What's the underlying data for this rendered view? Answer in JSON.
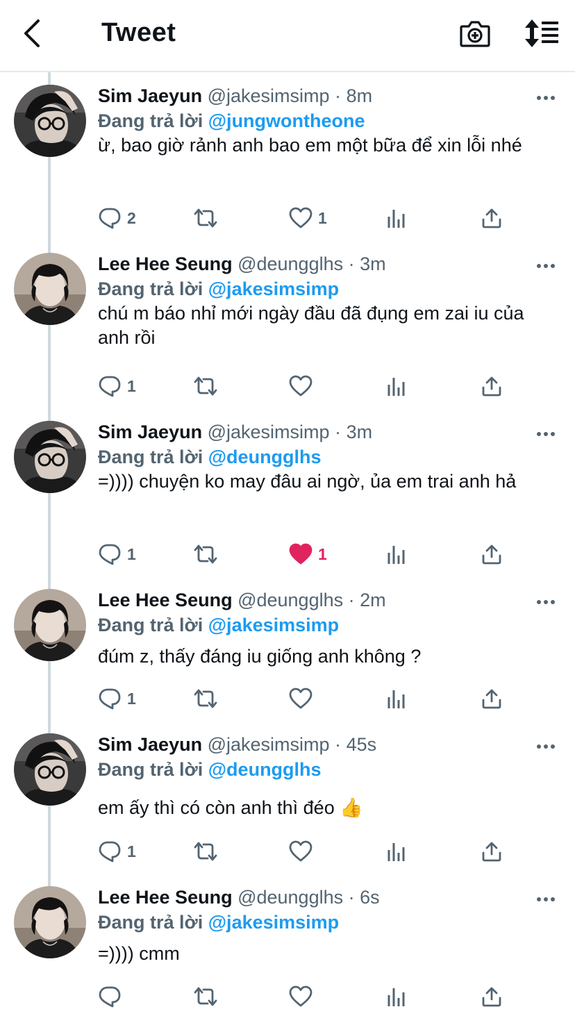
{
  "header": {
    "title": "Tweet"
  },
  "tweets": [
    {
      "avatar": "sim",
      "name": "Sim Jaeyun",
      "handle": "@jakesimsimp",
      "sep": "·",
      "time": "8m",
      "replying_label": "Đang trả lời",
      "replying_to": "@jungwontheone",
      "text": "ừ, bao giờ rảnh anh bao em một bữa để xin lỗi nhé",
      "replies": "2",
      "retweets": "",
      "likes": "1",
      "liked": false
    },
    {
      "avatar": "lee",
      "name": "Lee Hee Seung",
      "handle": "@deungglhs",
      "sep": "·",
      "time": "3m",
      "replying_label": "Đang trả lời",
      "replying_to": "@jakesimsimp",
      "text": "chú m báo nhỉ mới ngày đầu đã đụng em zai iu của anh rồi",
      "replies": "1",
      "retweets": "",
      "likes": "",
      "liked": false
    },
    {
      "avatar": "sim",
      "name": "Sim Jaeyun",
      "handle": "@jakesimsimp",
      "sep": "·",
      "time": "3m",
      "replying_label": "Đang trả lời",
      "replying_to": "@deungglhs",
      "text": "=)))) chuyện ko may đâu ai ngờ, ủa em trai anh hả",
      "replies": "1",
      "retweets": "",
      "likes": "1",
      "liked": true
    },
    {
      "avatar": "lee",
      "name": "Lee Hee Seung",
      "handle": "@deungglhs",
      "sep": "·",
      "time": "2m",
      "replying_label": "Đang trả lời",
      "replying_to": "@jakesimsimp",
      "text": "đúm z, thấy đáng iu giống anh không ?",
      "replies": "1",
      "retweets": "",
      "likes": "",
      "liked": false
    },
    {
      "avatar": "sim",
      "name": "Sim Jaeyun",
      "handle": "@jakesimsimp",
      "sep": "·",
      "time": "45s",
      "replying_label": "Đang trả lời",
      "replying_to": "@deungglhs",
      "text": "em ấy thì có còn anh thì đéo 👍",
      "replies": "1",
      "retweets": "",
      "likes": "",
      "liked": false
    },
    {
      "avatar": "lee",
      "name": "Lee Hee Seung",
      "handle": "@deungglhs",
      "sep": "·",
      "time": "6s",
      "replying_label": "Đang trả lời",
      "replying_to": "@jakesimsimp",
      "text": "=)))) cmm",
      "replies": "",
      "retweets": "",
      "likes": "",
      "liked": false
    }
  ],
  "colors": {
    "accent": "#1d9bf0",
    "like": "#e0245e",
    "muted": "#536471",
    "text": "#0f1419"
  },
  "icons": [
    "back-arrow-icon",
    "add-photo-icon",
    "sort-icon",
    "more-icon",
    "reply-icon",
    "retweet-icon",
    "heart-icon",
    "analytics-icon",
    "share-icon"
  ]
}
